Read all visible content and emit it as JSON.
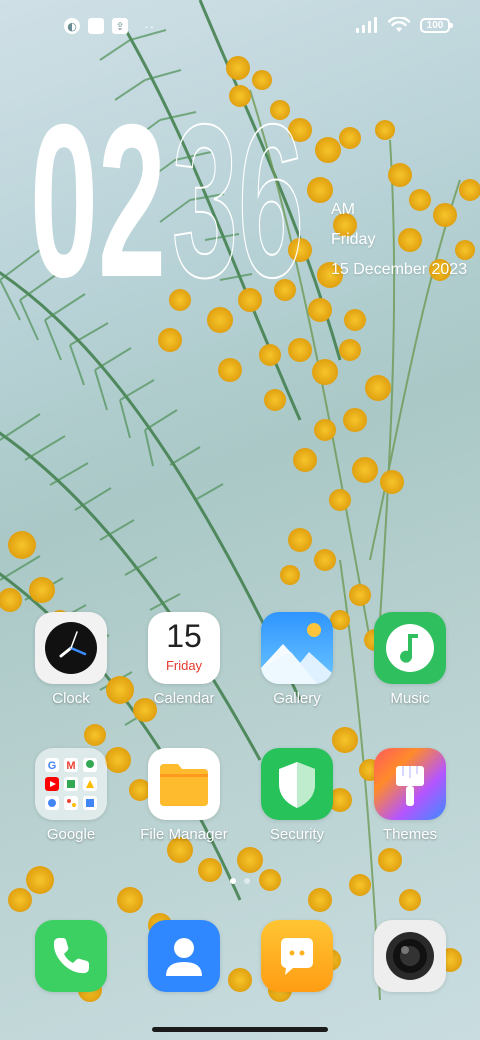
{
  "status_bar": {
    "left_icons": [
      "app-notification-icon",
      "square-notification-icon",
      "upload-notification-icon"
    ],
    "more_indicator": "··",
    "battery_level": "100",
    "signal_icon": "signal-bars-icon",
    "wifi_icon": "wifi-icon"
  },
  "clock": {
    "hours": "02",
    "minutes": "36",
    "ampm": "AM",
    "day": "Friday",
    "date": "15 December 2023"
  },
  "apps": [
    {
      "label": "Clock",
      "icon": "clock-icon"
    },
    {
      "label": "Calendar",
      "icon": "calendar-icon",
      "day_number": "15",
      "weekday": "Friday"
    },
    {
      "label": "Gallery",
      "icon": "gallery-icon"
    },
    {
      "label": "Music",
      "icon": "music-icon"
    },
    {
      "label": "Google",
      "icon": "google-folder-icon"
    },
    {
      "label": "File Manager",
      "icon": "folder-icon"
    },
    {
      "label": "Security",
      "icon": "shield-icon"
    },
    {
      "label": "Themes",
      "icon": "paintbrush-icon"
    }
  ],
  "dock": [
    {
      "icon": "phone-icon"
    },
    {
      "icon": "contacts-icon"
    },
    {
      "icon": "messages-icon"
    },
    {
      "icon": "camera-icon"
    }
  ],
  "page_indicator": {
    "pages": 2,
    "current": 1
  },
  "colors": {
    "music_green": "#2fbf5f",
    "security_green": "#27c25a",
    "phone_green": "#3ccf62",
    "contacts_blue": "#2f88ff",
    "messages_orange": "#ffb21f",
    "folder_yellow": "#ffbb2e",
    "calendar_red": "#e5392f"
  }
}
